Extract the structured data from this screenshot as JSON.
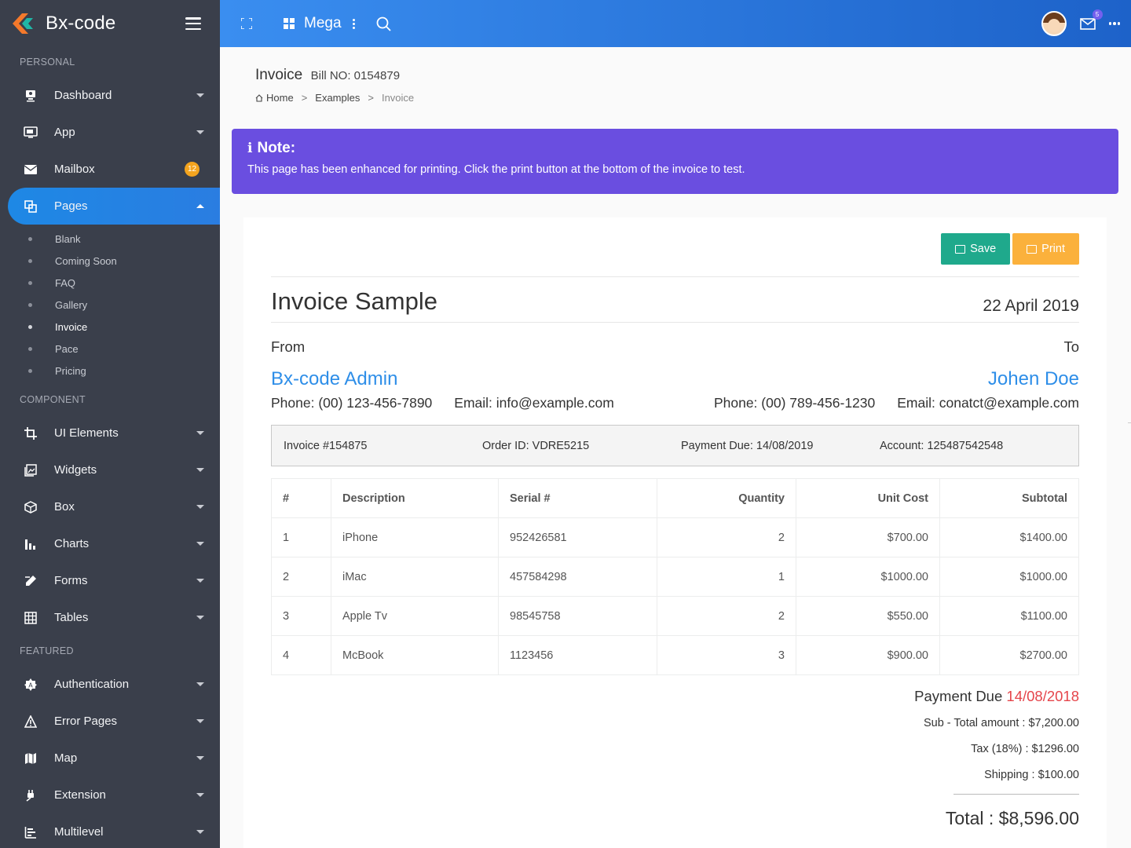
{
  "brand": {
    "name": "Bx-code"
  },
  "sidebar": {
    "sections": {
      "personal": "PERSONAL",
      "component": "COMPONENT",
      "featured": "FEATURED"
    },
    "items": {
      "dashboard": "Dashboard",
      "app": "App",
      "mailbox": "Mailbox",
      "mailbox_badge": "12",
      "pages": "Pages",
      "ui_elements": "UI Elements",
      "widgets": "Widgets",
      "box": "Box",
      "charts": "Charts",
      "forms": "Forms",
      "tables": "Tables",
      "authentication": "Authentication",
      "error_pages": "Error Pages",
      "map": "Map",
      "extension": "Extension",
      "multilevel": "Multilevel"
    },
    "pages_sub": [
      "Blank",
      "Coming Soon",
      "FAQ",
      "Gallery",
      "Invoice",
      "Pace",
      "Pricing"
    ]
  },
  "topbar": {
    "mega": "Mega",
    "mail_count": "5"
  },
  "header": {
    "title": "Invoice",
    "bill": "Bill NO: 0154879",
    "breadcrumb": {
      "home": "Home",
      "examples": "Examples",
      "current": "Invoice",
      "sep": ">"
    }
  },
  "note": {
    "title": "Note:",
    "text": "This page has been enhanced for printing. Click the print button at the bottom of the invoice to test."
  },
  "invoice": {
    "save_label": "Save",
    "print_label": "Print",
    "title": "Invoice Sample",
    "date": "22 April 2019",
    "from_label": "From",
    "to_label": "To",
    "from_name": "Bx-code Admin",
    "from_phone": "Phone: (00) 123-456-7890",
    "from_email": "Email: info@example.com",
    "to_name": "Johen Doe",
    "to_phone": "Phone: (00) 789-456-1230",
    "to_email": "Email: conatct@example.com",
    "meta": {
      "invoice_no": "Invoice #154875",
      "order_id": "Order ID: VDRE5215",
      "payment_due": "Payment Due: 14/08/2019",
      "account": "Account: 125487542548"
    },
    "columns": [
      "#",
      "Description",
      "Serial #",
      "Quantity",
      "Unit Cost",
      "Subtotal"
    ],
    "rows": [
      [
        "1",
        "iPhone",
        "952426581",
        "2",
        "$700.00",
        "$1400.00"
      ],
      [
        "2",
        "iMac",
        "457584298",
        "1",
        "$1000.00",
        "$1000.00"
      ],
      [
        "3",
        "Apple Tv",
        "98545758",
        "2",
        "$550.00",
        "$1100.00"
      ],
      [
        "4",
        "McBook",
        "1123456",
        "3",
        "$900.00",
        "$2700.00"
      ]
    ],
    "summary": {
      "payment_due_label": "Payment Due",
      "payment_due_date": "14/08/2018",
      "subtotal": "Sub - Total amount : $7,200.00",
      "tax": "Tax (18%) : $1296.00",
      "shipping": "Shipping : $100.00",
      "total": "Total : $8,596.00"
    }
  },
  "colors": {
    "sidebar_bg": "#3a3f4b",
    "topbar_start": "#3a8ef0",
    "topbar_end": "#1d62c9",
    "note_bg": "#6a4ee0",
    "save_btn": "#1fa98c",
    "print_btn": "#fbb13c",
    "accent_blue": "#2e8ee8",
    "due_red": "#e5454b",
    "badge_orange": "#f4a41e"
  },
  "icons": {
    "dashboard": "monitor-user-icon",
    "app": "desktop-icon",
    "mailbox": "envelope-icon",
    "pages": "copy-icon",
    "ui_elements": "crop-icon",
    "widgets": "image-gallery-icon",
    "box": "cube-icon",
    "charts": "bar-chart-icon",
    "forms": "pencil-icon",
    "tables": "grid-table-icon",
    "authentication": "gear-badge-icon",
    "error_pages": "warning-icon",
    "map": "map-icon",
    "extension": "plug-icon",
    "multilevel": "tree-list-icon"
  }
}
